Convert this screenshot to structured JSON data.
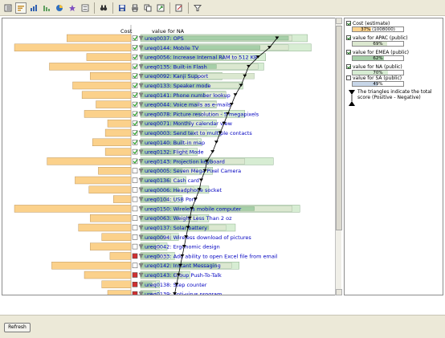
{
  "toolbar": {
    "buttons": [
      "view-options-icon",
      "sort-icon",
      "chart-icon",
      "chart-alt-icon",
      "pie-icon",
      "star-icon",
      "filter-list-icon",
      "binoculars-icon",
      "save-icon",
      "print-icon",
      "copy-icon",
      "export-icon",
      "edit-icon",
      "funnel-icon"
    ]
  },
  "chart": {
    "header_cost": "Cost",
    "header_value": "value for NA",
    "colors": {
      "cost": "#fbd18b",
      "apac": "#dbe8d0",
      "emea": "#a6cfa8",
      "na": "#d7edd3",
      "sa": "#c7d6e8",
      "label_link": "#0000c0",
      "check_green": "#28a028",
      "check_red": "#d03030"
    },
    "rows": [
      {
        "label": "ureq0037: OPS",
        "cost": 0.55,
        "apac": 0.8,
        "emea": 0.78,
        "na": 0.88,
        "selected": true,
        "score": 0.72
      },
      {
        "label": "ureq0144: Mobile TV",
        "cost": 1.0,
        "apac": 0.78,
        "emea": 0.63,
        "na": 0.9,
        "selected": true,
        "score": 0.68
      },
      {
        "label": "ureq0056: Increase Internal RAM to 512 KB",
        "cost": 0.38,
        "apac": 0.52,
        "emea": 0.44,
        "na": 0.66,
        "selected": true,
        "score": 0.62
      },
      {
        "label": "ureq0135: Built-in Flash",
        "cost": 0.7,
        "apac": 0.62,
        "emea": 0.4,
        "na": 0.65,
        "selected": true,
        "score": 0.57
      },
      {
        "label": "ureq0092: Kanji Support",
        "cost": 0.35,
        "apac": 0.6,
        "emea": 0.3,
        "na": 0.43,
        "selected": true,
        "score": 0.55
      },
      {
        "label": "ureq0133: Speaker mode",
        "cost": 0.5,
        "apac": 0.52,
        "emea": 0.36,
        "na": 0.54,
        "selected": true,
        "score": 0.53
      },
      {
        "label": "ureq0141: Phone number lookup",
        "cost": 0.42,
        "apac": 0.45,
        "emea": 0.34,
        "na": 0.45,
        "selected": true,
        "score": 0.5
      },
      {
        "label": "ureq0044: Voice mails as e-mails",
        "cost": 0.3,
        "apac": 0.4,
        "emea": 0.3,
        "na": 0.4,
        "selected": true,
        "score": 0.48
      },
      {
        "label": "ureq0078: Picture resolution - 5 megapixels",
        "cost": 0.4,
        "apac": 0.43,
        "emea": 0.32,
        "na": 0.55,
        "selected": true,
        "score": 0.46
      },
      {
        "label": "ureq0071: Monthly calendar view",
        "cost": 0.2,
        "apac": 0.32,
        "emea": 0.26,
        "na": 0.4,
        "selected": true,
        "score": 0.44
      },
      {
        "label": "ureq0003: Send text to multiple contacts",
        "cost": 0.22,
        "apac": 0.35,
        "emea": 0.28,
        "na": 0.42,
        "selected": true,
        "score": 0.42
      },
      {
        "label": "ureq0140: Built-in map",
        "cost": 0.33,
        "apac": 0.3,
        "emea": 0.22,
        "na": 0.32,
        "selected": true,
        "score": 0.4
      },
      {
        "label": "ureq0132: Flight Mode",
        "cost": 0.22,
        "apac": 0.25,
        "emea": 0.18,
        "na": 0.3,
        "selected": true,
        "score": 0.38
      },
      {
        "label": "ureq0143: Projection keyboard",
        "cost": 0.72,
        "apac": 0.55,
        "emea": 0.38,
        "na": 0.7,
        "selected": true,
        "score": 0.35
      },
      {
        "label": "ureq0005: Seven Mega Pixel Camera",
        "cost": 0.28,
        "apac": 0.3,
        "emea": 0.22,
        "na": 0.38,
        "selected": false,
        "score": 0.34
      },
      {
        "label": "ureq0136: Cash card",
        "cost": 0.48,
        "apac": 0.2,
        "emea": 0.16,
        "na": 0.24,
        "selected": false,
        "score": 0.32
      },
      {
        "label": "ureq0006: Headphone socket",
        "cost": 0.36,
        "apac": 0.28,
        "emea": 0.2,
        "na": 0.36,
        "selected": false,
        "score": 0.31
      },
      {
        "label": "ureq0104: USB Port",
        "cost": 0.15,
        "apac": 0.18,
        "emea": 0.14,
        "na": 0.22,
        "selected": false,
        "score": 0.29
      },
      {
        "label": "ureq0150: Wireless mobile computer",
        "cost": 1.0,
        "apac": 0.8,
        "emea": 0.6,
        "na": 0.84,
        "selected": false,
        "score": 0.27
      },
      {
        "label": "ureq0063: Weight Less Than 2 oz",
        "cost": 0.35,
        "apac": 0.3,
        "emea": 0.2,
        "na": 0.36,
        "selected": false,
        "score": 0.26
      },
      {
        "label": "ureq0137: Solar battery",
        "cost": 0.45,
        "apac": 0.45,
        "emea": 0.36,
        "na": 0.5,
        "selected": false,
        "score": 0.25
      },
      {
        "label": "ureq0094: Wireless download of pictures",
        "cost": 0.25,
        "apac": 0.16,
        "emea": 0.12,
        "na": 0.2,
        "selected": false,
        "score": 0.24
      },
      {
        "label": "ureq0042: Ergonomic design",
        "cost": 0.35,
        "apac": 0.1,
        "emea": 0.08,
        "na": 0.14,
        "selected": false,
        "score": 0.23
      },
      {
        "label": "ureq0033: Add ability to open Excel file from email",
        "cost": 0.18,
        "apac": 0.14,
        "emea": 0.1,
        "na": 0.18,
        "selected": false,
        "score": 0.22,
        "flag": true
      },
      {
        "label": "ureq0142: Instant Messaging",
        "cost": 0.68,
        "apac": 0.48,
        "emea": 0.4,
        "na": 0.52,
        "selected": false,
        "score": 0.21
      },
      {
        "label": "ureq0143: Group Push-To-Talk",
        "cost": 0.4,
        "apac": 0.22,
        "emea": 0.18,
        "na": 0.26,
        "selected": false,
        "score": 0.2,
        "flag": true
      },
      {
        "label": "ureq0138: Step counter",
        "cost": 0.25,
        "apac": 0.08,
        "emea": 0.06,
        "na": 0.1,
        "selected": false,
        "score": 0.19,
        "flag": true
      },
      {
        "label": "ureq0139: Anti-virus program",
        "cost": 0.2,
        "apac": 0.08,
        "emea": 0.06,
        "na": 0.1,
        "selected": false,
        "score": 0.18,
        "flag": true
      }
    ]
  },
  "legend": {
    "items": [
      {
        "label": "Cost (estimate)",
        "value_text": "37% (1008000)",
        "fraction": 0.37,
        "color": "#fbd18b",
        "checked": true
      },
      {
        "label": "value for APAC (public)",
        "value_text": "69%",
        "fraction": 0.69,
        "color": "#dbe8d0",
        "checked": true
      },
      {
        "label": "value for EMEA (public)",
        "value_text": "62%",
        "fraction": 0.62,
        "color": "#a6cfa8",
        "checked": true
      },
      {
        "label": "value for NA (public)",
        "value_text": "70%",
        "fraction": 0.7,
        "color": "#d7edd3",
        "checked": true
      },
      {
        "label": "value for SA (public)",
        "value_text": "49%",
        "fraction": 0.49,
        "color": "#c7d6e8",
        "checked": false
      }
    ],
    "triangle_note": "The triangles indicate the total score (Positive - Negative)"
  },
  "bottom": {
    "refresh_label": "Refresh"
  }
}
